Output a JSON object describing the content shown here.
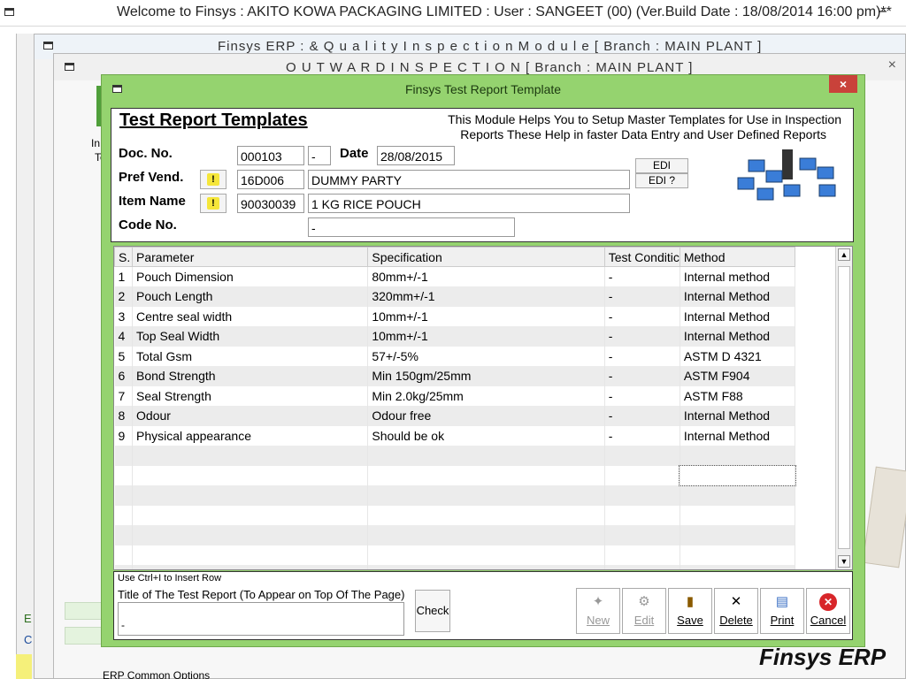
{
  "main_window": {
    "title": "Welcome to Finsys : AKITO KOWA PACKAGING LIMITED : User : SANGEET (00) (Ver.Build Date : 18/08/2014 16:00 pm)**",
    "minimize": "–",
    "close": "×"
  },
  "bg_window1": {
    "title": "Finsys ERP  :  & Q u a l i t y   I n s p e c t i o n   M o d u l e      [ Branch : MAIN PLANT ]"
  },
  "bg_window2": {
    "title": "O U T W A R D   I N S P E C T I O N        [ Branch : MAIN PLANT ]",
    "close": "×"
  },
  "bg_fragments": {
    "left_1": "In",
    "left_2": "Te",
    "side_e": "E",
    "side_c": "C",
    "bottom_option": "ERP Common Options"
  },
  "dialog": {
    "title": "Finsys Test Report Template",
    "close": "×",
    "heading": "Test Report Templates",
    "description_line1": "This Module Helps You to Setup Master Templates for Use in Inspection",
    "description_line2": "Reports These Help in faster Data Entry and User Defined Reports",
    "doc_no_label": "Doc. No.",
    "doc_no": "000103",
    "doc_suffix": "-",
    "date_label": "Date",
    "date": "28/08/2015",
    "pref_vend_label": "Pref Vend.",
    "vend_code": "16D006",
    "vend_name": "DUMMY PARTY",
    "item_name_label": "Item Name",
    "item_code": "90030039",
    "item_name": "1 KG RICE POUCH",
    "code_no_label": "Code No.",
    "code_no": "-",
    "edi_label": "EDI",
    "edi_q_label": "EDI ?",
    "warn_icon": "!"
  },
  "grid": {
    "headers": [
      "S.",
      "Parameter",
      "Specification",
      "Test Conditic",
      "Method"
    ],
    "rows": [
      [
        "1",
        "Pouch Dimension",
        "80mm+/-1",
        "-",
        "Internal method"
      ],
      [
        "2",
        "Pouch Length",
        "320mm+/-1",
        "-",
        "Internal Method"
      ],
      [
        "3",
        "Centre seal width",
        "10mm+/-1",
        "-",
        "Internal Method"
      ],
      [
        "4",
        "Top Seal Width",
        "10mm+/-1",
        "-",
        "Internal Method"
      ],
      [
        "5",
        "Total Gsm",
        "57+/-5%",
        "-",
        "ASTM D 4321"
      ],
      [
        "6",
        "Bond Strength",
        "Min 150gm/25mm",
        "-",
        "ASTM F904"
      ],
      [
        "7",
        "Seal Strength",
        "Min 2.0kg/25mm",
        "-",
        "ASTM F88"
      ],
      [
        "8",
        "Odour",
        "Odour free",
        "-",
        "Internal Method"
      ],
      [
        "9",
        "Physical appearance",
        "Should be ok",
        "-",
        "Internal Method"
      ]
    ],
    "empty_rows": 7
  },
  "bottom": {
    "hint": "Use Ctrl+I to Insert Row",
    "title_label": "Title of The Test Report (To Appear on Top Of The Page)",
    "title_value": "-",
    "check_label": "Check",
    "buttons": {
      "new": "New",
      "edit": "Edit",
      "save": "Save",
      "delete": "Delete",
      "print": "Print",
      "cancel": "Cancel"
    }
  },
  "brand": {
    "line1": "Finsys ERP",
    "line2": "Finsys ERP"
  },
  "icons": [
    "window-icon",
    "warning-icon",
    "computers-network-icon",
    "new-icon",
    "edit-icon",
    "save-icon",
    "delete-icon",
    "print-icon",
    "cancel-icon"
  ]
}
